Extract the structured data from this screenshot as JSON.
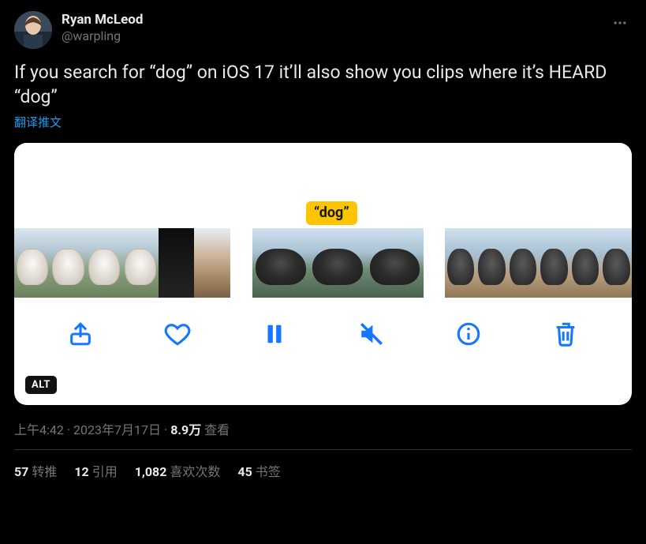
{
  "user": {
    "display_name": "Ryan McLeod",
    "handle": "@warpling"
  },
  "tweet_text": "If you search for “dog” on iOS 17 it’ll also show you clips where it’s HEARD “dog”",
  "translate_label": "翻译推文",
  "media": {
    "tooltip_text": "“dog”",
    "alt_badge": "ALT"
  },
  "meta": {
    "time": "上午4:42",
    "date": "2023年7月17日",
    "views_number": "8.9万",
    "views_label": "查看"
  },
  "stats": {
    "retweet_count": "57",
    "retweet_label": "转推",
    "quote_count": "12",
    "quote_label": "引用",
    "like_count": "1,082",
    "like_label": "喜欢次数",
    "bookmark_count": "45",
    "bookmark_label": "书签"
  }
}
